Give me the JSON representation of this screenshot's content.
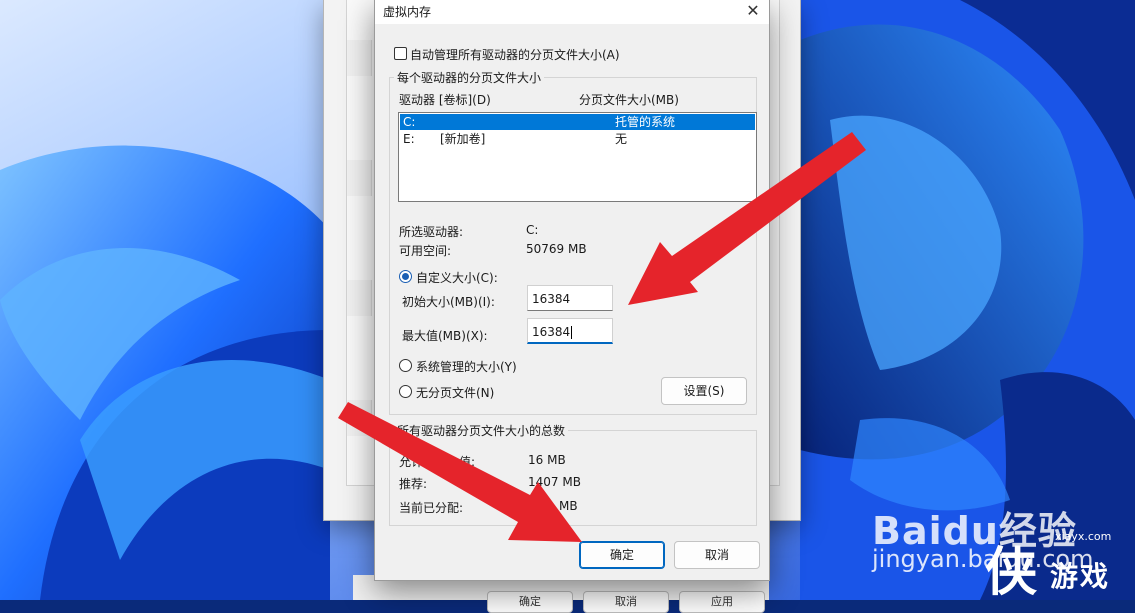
{
  "dialog": {
    "title": "虚拟内存",
    "close_glyph": "✕",
    "auto_manage_label": "自动管理所有驱动器的分页文件大小(A)",
    "auto_manage_checked": false,
    "per_drive_group_label": "每个驱动器的分页文件大小",
    "col_drive": "驱动器 [卷标](D)",
    "col_size": "分页文件大小(MB)",
    "drives": [
      {
        "drive": "C:",
        "label": "",
        "size": "托管的系统",
        "selected": true
      },
      {
        "drive": "E:",
        "label": "[新加卷]",
        "size": "无",
        "selected": false
      }
    ],
    "selected_drive_label": "所选驱动器:",
    "selected_drive_value": "C:",
    "free_space_label": "可用空间:",
    "free_space_value": "50769 MB",
    "custom_size_label": "自定义大小(C):",
    "initial_size_label": "初始大小(MB)(I):",
    "initial_size_value": "16384",
    "max_size_label": "最大值(MB)(X):",
    "max_size_value": "16384",
    "system_managed_label": "系统管理的大小(Y)",
    "no_paging_label": "无分页文件(N)",
    "set_button": "设置(S)",
    "total_group_label": "所有驱动器分页文件大小的总数",
    "min_allowed_label_visible": "允许的最小值:",
    "min_allowed_value": "16 MB",
    "recommended_label": "推荐:",
    "recommended_value": "1407 MB",
    "current_label": "当前已分配:",
    "current_value_visible": "MB",
    "ok_button": "确定",
    "cancel_button": "取消"
  },
  "background_dialog": {
    "footer_buttons": [
      "确定",
      "取消",
      "应用"
    ]
  },
  "watermark": {
    "baidu_text": "Baidu经验",
    "jingyan_text": "jingyan.baidu.com",
    "site_small": "xiayx.com",
    "site_big_char": "侠",
    "site_name": "游戏"
  },
  "colors": {
    "accent": "#0078d7",
    "arrow": "#e5242b"
  }
}
